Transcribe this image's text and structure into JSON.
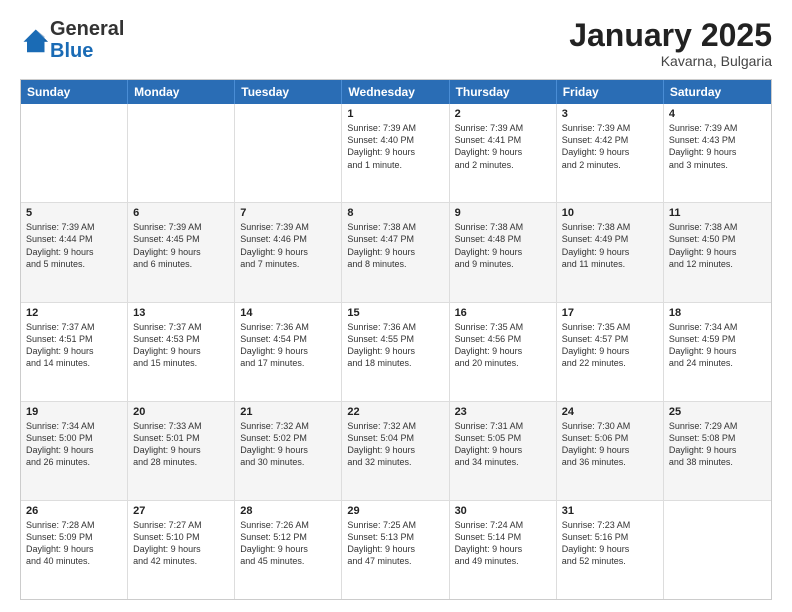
{
  "logo": {
    "line1": "General",
    "line2": "Blue"
  },
  "title": {
    "month": "January 2025",
    "location": "Kavarna, Bulgaria"
  },
  "calendar": {
    "headers": [
      "Sunday",
      "Monday",
      "Tuesday",
      "Wednesday",
      "Thursday",
      "Friday",
      "Saturday"
    ],
    "rows": [
      [
        {
          "day": "",
          "info": "",
          "empty": true
        },
        {
          "day": "",
          "info": "",
          "empty": true
        },
        {
          "day": "",
          "info": "",
          "empty": true
        },
        {
          "day": "1",
          "info": "Sunrise: 7:39 AM\nSunset: 4:40 PM\nDaylight: 9 hours\nand 1 minute."
        },
        {
          "day": "2",
          "info": "Sunrise: 7:39 AM\nSunset: 4:41 PM\nDaylight: 9 hours\nand 2 minutes."
        },
        {
          "day": "3",
          "info": "Sunrise: 7:39 AM\nSunset: 4:42 PM\nDaylight: 9 hours\nand 2 minutes."
        },
        {
          "day": "4",
          "info": "Sunrise: 7:39 AM\nSunset: 4:43 PM\nDaylight: 9 hours\nand 3 minutes."
        }
      ],
      [
        {
          "day": "5",
          "info": "Sunrise: 7:39 AM\nSunset: 4:44 PM\nDaylight: 9 hours\nand 5 minutes."
        },
        {
          "day": "6",
          "info": "Sunrise: 7:39 AM\nSunset: 4:45 PM\nDaylight: 9 hours\nand 6 minutes."
        },
        {
          "day": "7",
          "info": "Sunrise: 7:39 AM\nSunset: 4:46 PM\nDaylight: 9 hours\nand 7 minutes."
        },
        {
          "day": "8",
          "info": "Sunrise: 7:38 AM\nSunset: 4:47 PM\nDaylight: 9 hours\nand 8 minutes."
        },
        {
          "day": "9",
          "info": "Sunrise: 7:38 AM\nSunset: 4:48 PM\nDaylight: 9 hours\nand 9 minutes."
        },
        {
          "day": "10",
          "info": "Sunrise: 7:38 AM\nSunset: 4:49 PM\nDaylight: 9 hours\nand 11 minutes."
        },
        {
          "day": "11",
          "info": "Sunrise: 7:38 AM\nSunset: 4:50 PM\nDaylight: 9 hours\nand 12 minutes."
        }
      ],
      [
        {
          "day": "12",
          "info": "Sunrise: 7:37 AM\nSunset: 4:51 PM\nDaylight: 9 hours\nand 14 minutes."
        },
        {
          "day": "13",
          "info": "Sunrise: 7:37 AM\nSunset: 4:53 PM\nDaylight: 9 hours\nand 15 minutes."
        },
        {
          "day": "14",
          "info": "Sunrise: 7:36 AM\nSunset: 4:54 PM\nDaylight: 9 hours\nand 17 minutes."
        },
        {
          "day": "15",
          "info": "Sunrise: 7:36 AM\nSunset: 4:55 PM\nDaylight: 9 hours\nand 18 minutes."
        },
        {
          "day": "16",
          "info": "Sunrise: 7:35 AM\nSunset: 4:56 PM\nDaylight: 9 hours\nand 20 minutes."
        },
        {
          "day": "17",
          "info": "Sunrise: 7:35 AM\nSunset: 4:57 PM\nDaylight: 9 hours\nand 22 minutes."
        },
        {
          "day": "18",
          "info": "Sunrise: 7:34 AM\nSunset: 4:59 PM\nDaylight: 9 hours\nand 24 minutes."
        }
      ],
      [
        {
          "day": "19",
          "info": "Sunrise: 7:34 AM\nSunset: 5:00 PM\nDaylight: 9 hours\nand 26 minutes."
        },
        {
          "day": "20",
          "info": "Sunrise: 7:33 AM\nSunset: 5:01 PM\nDaylight: 9 hours\nand 28 minutes."
        },
        {
          "day": "21",
          "info": "Sunrise: 7:32 AM\nSunset: 5:02 PM\nDaylight: 9 hours\nand 30 minutes."
        },
        {
          "day": "22",
          "info": "Sunrise: 7:32 AM\nSunset: 5:04 PM\nDaylight: 9 hours\nand 32 minutes."
        },
        {
          "day": "23",
          "info": "Sunrise: 7:31 AM\nSunset: 5:05 PM\nDaylight: 9 hours\nand 34 minutes."
        },
        {
          "day": "24",
          "info": "Sunrise: 7:30 AM\nSunset: 5:06 PM\nDaylight: 9 hours\nand 36 minutes."
        },
        {
          "day": "25",
          "info": "Sunrise: 7:29 AM\nSunset: 5:08 PM\nDaylight: 9 hours\nand 38 minutes."
        }
      ],
      [
        {
          "day": "26",
          "info": "Sunrise: 7:28 AM\nSunset: 5:09 PM\nDaylight: 9 hours\nand 40 minutes."
        },
        {
          "day": "27",
          "info": "Sunrise: 7:27 AM\nSunset: 5:10 PM\nDaylight: 9 hours\nand 42 minutes."
        },
        {
          "day": "28",
          "info": "Sunrise: 7:26 AM\nSunset: 5:12 PM\nDaylight: 9 hours\nand 45 minutes."
        },
        {
          "day": "29",
          "info": "Sunrise: 7:25 AM\nSunset: 5:13 PM\nDaylight: 9 hours\nand 47 minutes."
        },
        {
          "day": "30",
          "info": "Sunrise: 7:24 AM\nSunset: 5:14 PM\nDaylight: 9 hours\nand 49 minutes."
        },
        {
          "day": "31",
          "info": "Sunrise: 7:23 AM\nSunset: 5:16 PM\nDaylight: 9 hours\nand 52 minutes."
        },
        {
          "day": "",
          "info": "",
          "empty": true
        }
      ]
    ]
  }
}
